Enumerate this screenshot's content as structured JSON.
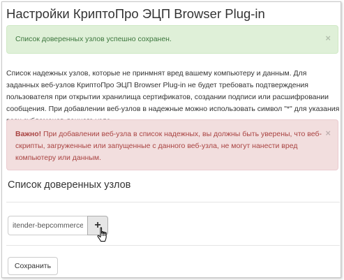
{
  "page": {
    "title": "Настройки КриптоПро ЭЦП Browser Plug-in"
  },
  "success_alert": {
    "message": "Список доверенных узлов успешно сохранен.",
    "close": "×"
  },
  "info_text": "Список надежных узлов, которые не принмнят вред вашему компьютеру и данным. Для заданных веб-узлов КриптоПро ЭЦП Browser Plug-in не будет требовать подтверждения пользователя при открытии хранилища сертификатов, создании подписи или расшифровании сообщения. При добавлении веб-узлов в надежные можно использовать символ \"*\" для указания всех субдоменов данного узла.",
  "warning_alert": {
    "strong": "Важно!",
    "message": " При добавлении веб-узла в список надежных, вы должны быть уверены, что веб-скрипты, загруженные или запущенные с данного веб-узла, не могут нанести вред компьютеру или данным.",
    "close": "×"
  },
  "trusted_nodes": {
    "heading": "Список доверенных узлов",
    "input_value": "itender-bepcommerce",
    "add_label": "+"
  },
  "save_button": "Сохранить",
  "colors": {
    "success_bg": "#dff0d8",
    "success_text": "#3c763d",
    "danger_bg": "#f2dede",
    "danger_text": "#a94442"
  },
  "icons": {
    "cursor": "hand-pointer-icon"
  }
}
